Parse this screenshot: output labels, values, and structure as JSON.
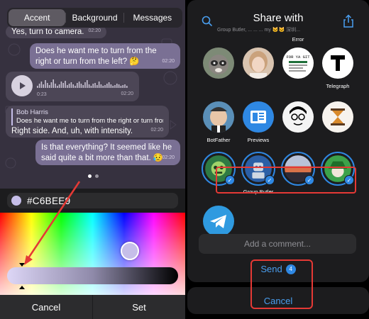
{
  "left": {
    "tabs": [
      "Accent",
      "Background",
      "Messages"
    ],
    "active_tab": 0,
    "messages": [
      {
        "dir": "in",
        "text": "Yes, turn to camera.",
        "time": "02:20"
      },
      {
        "dir": "out",
        "text": "Does he want me to turn from the right or turn from the left? 🤔",
        "time": "02:20"
      },
      {
        "dir": "in",
        "voice_duration": "0:23",
        "time": "02:20"
      },
      {
        "dir": "in",
        "reply_name": "Bob Harris",
        "reply_text": "Does he want me to turn from the right or turn from...",
        "text": "Right side. And, uh, with intensity.",
        "time": "02:20"
      },
      {
        "dir": "out",
        "text": "Is that everything? It seemed like he said quite a bit more than that. 😥",
        "time": "02:20"
      }
    ],
    "hex_value": "#C6BEE9",
    "cancel_label": "Cancel",
    "set_label": "Set",
    "colors": {
      "accent": "#C6BEE9",
      "chat_bg": "#36313f",
      "bubble_out": "#7a7094",
      "bubble_in": "#4c4656"
    }
  },
  "right": {
    "title": "Share with",
    "subtitle": "Group Butler, ...   ...   ...   my 🐱🐱   深圳...",
    "contacts": [
      {
        "name": "",
        "selected": false,
        "avatar": "raccoon"
      },
      {
        "name": "",
        "selected": false,
        "avatar": "girl"
      },
      {
        "name": "Error",
        "selected": false,
        "avatar": "error-doc"
      },
      {
        "name": "Telegraph",
        "selected": false,
        "avatar": "telegraph-t"
      },
      {
        "name": "BotFather",
        "selected": false,
        "avatar": "botfather"
      },
      {
        "name": "Previews",
        "selected": false,
        "avatar": "previews"
      },
      {
        "name": "",
        "selected": false,
        "avatar": "cartoon-face"
      },
      {
        "name": "",
        "selected": false,
        "avatar": "hourglass"
      },
      {
        "name": "",
        "selected": true,
        "avatar": "green-robot"
      },
      {
        "name": "Group Butler",
        "selected": true,
        "avatar": "butler-robot"
      },
      {
        "name": "",
        "selected": true,
        "avatar": "sunset-photo"
      },
      {
        "name": "",
        "selected": true,
        "avatar": "green-hat"
      },
      {
        "name": "",
        "selected": false,
        "avatar": "telegram-logo"
      }
    ],
    "comment_placeholder": "Add a comment...",
    "send_label": "Send",
    "send_count": "4",
    "cancel_label": "Cancel",
    "colors": {
      "accent": "#2f88e3",
      "link": "#4a9ff0",
      "highlight": "#e53935"
    }
  }
}
